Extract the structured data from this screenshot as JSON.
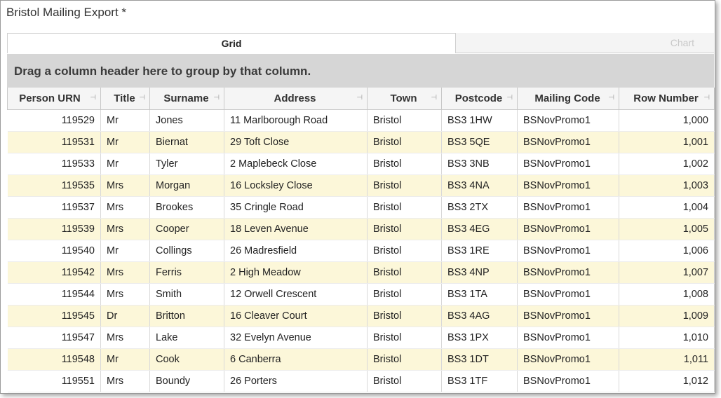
{
  "window": {
    "title": "Bristol Mailing Export *"
  },
  "tabs": [
    {
      "label": "Grid",
      "active": true
    },
    {
      "label": "Chart",
      "active": false
    }
  ],
  "group_panel": {
    "hint": "Drag a column header here to group by that column."
  },
  "columns": [
    "Person URN",
    "Title",
    "Surname",
    "Address",
    "Town",
    "Postcode",
    "Mailing Code",
    "Row Number"
  ],
  "rows": [
    [
      "119529",
      "Mr",
      "Jones",
      "11 Marlborough Road",
      "Bristol",
      "BS3 1HW",
      "BSNovPromo1",
      "1,000"
    ],
    [
      "119531",
      "Mr",
      "Biernat",
      "29 Toft Close",
      "Bristol",
      "BS3 5QE",
      "BSNovPromo1",
      "1,001"
    ],
    [
      "119533",
      "Mr",
      "Tyler",
      "2 Maplebeck Close",
      "Bristol",
      "BS3 3NB",
      "BSNovPromo1",
      "1,002"
    ],
    [
      "119535",
      "Mrs",
      "Morgan",
      "16 Locksley Close",
      "Bristol",
      "BS3 4NA",
      "BSNovPromo1",
      "1,003"
    ],
    [
      "119537",
      "Mrs",
      "Brookes",
      "35 Cringle Road",
      "Bristol",
      "BS3 2TX",
      "BSNovPromo1",
      "1,004"
    ],
    [
      "119539",
      "Mrs",
      "Cooper",
      "18 Leven Avenue",
      "Bristol",
      "BS3 4EG",
      "BSNovPromo1",
      "1,005"
    ],
    [
      "119540",
      "Mr",
      "Collings",
      "26 Madresfield",
      "Bristol",
      "BS3 1RE",
      "BSNovPromo1",
      "1,006"
    ],
    [
      "119542",
      "Mrs",
      "Ferris",
      "2 High Meadow",
      "Bristol",
      "BS3 4NP",
      "BSNovPromo1",
      "1,007"
    ],
    [
      "119544",
      "Mrs",
      "Smith",
      "12 Orwell Crescent",
      "Bristol",
      "BS3 1TA",
      "BSNovPromo1",
      "1,008"
    ],
    [
      "119545",
      "Dr",
      "Britton",
      "16 Cleaver Court",
      "Bristol",
      "BS3 4AG",
      "BSNovPromo1",
      "1,009"
    ],
    [
      "119547",
      "Mrs",
      "Lake",
      "32 Evelyn Avenue",
      "Bristol",
      "BS3 1PX",
      "BSNovPromo1",
      "1,010"
    ],
    [
      "119548",
      "Mr",
      "Cook",
      "6 Canberra",
      "Bristol",
      "BS3 1DT",
      "BSNovPromo1",
      "1,011"
    ],
    [
      "119551",
      "Mrs",
      "Boundy",
      "26 Porters",
      "Bristol",
      "BS3 1TF",
      "BSNovPromo1",
      "1,012"
    ]
  ],
  "icons": {
    "column_pin": "pin-icon"
  },
  "colors": {
    "alt_row": "#fcf7d9",
    "group_panel": "#d6d6d6"
  }
}
